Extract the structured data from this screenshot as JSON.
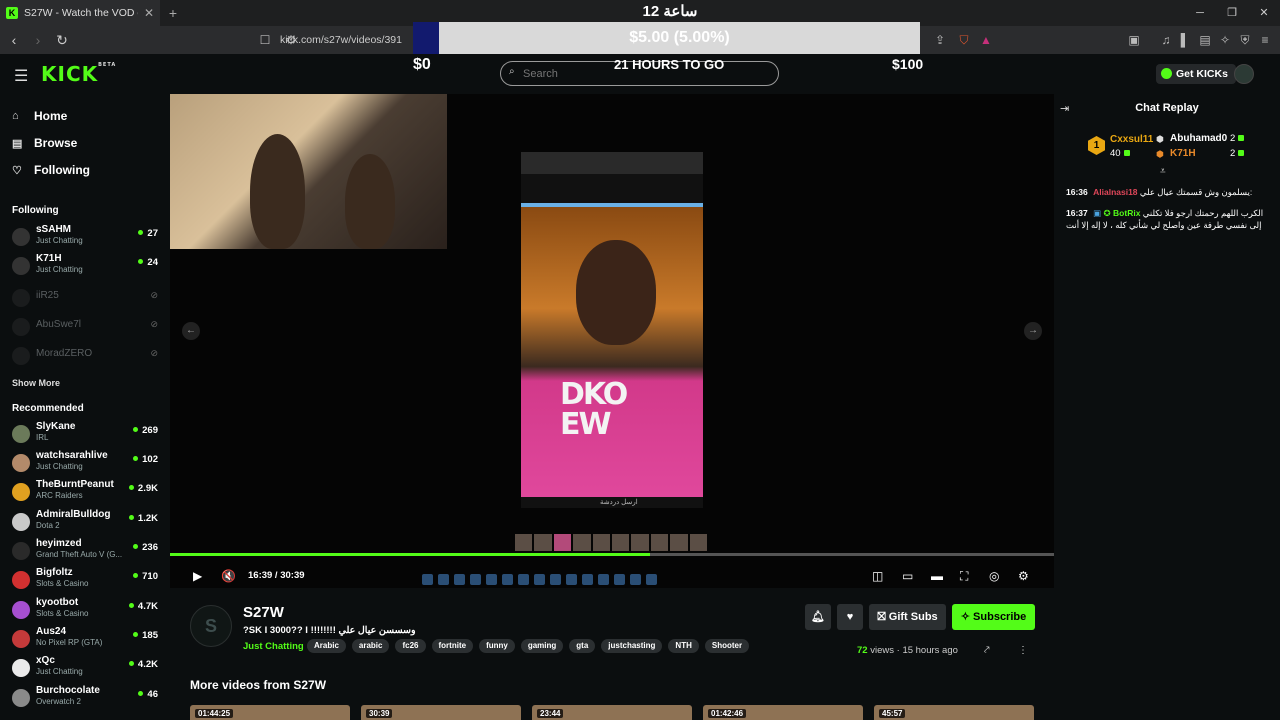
{
  "browser": {
    "tab_title": "S27W - Watch the VOD on Kick",
    "url": "kick.com/s27w/videos/391"
  },
  "overlay": {
    "arabic_time": "ساعة 12",
    "goal_progress": "$5.00 (5.00%)",
    "goal_min": "$0",
    "goal_max": "$100",
    "time_left": "21 HOURS TO GO",
    "goal_fraction": 0.05
  },
  "header": {
    "logo": "KICK",
    "logo_badge": "BETA",
    "search_placeholder": "Search",
    "get_kicks": "Get KICKs"
  },
  "sidebar": {
    "nav": [
      {
        "label": "Home",
        "icon": "home-icon"
      },
      {
        "label": "Browse",
        "icon": "browse-icon"
      },
      {
        "label": "Following",
        "icon": "heart-icon"
      }
    ],
    "following_title": "Following",
    "following": [
      {
        "name": "sSAHM",
        "category": "Just Chatting",
        "viewers": "27",
        "live": true
      },
      {
        "name": "K71H",
        "category": "Just Chatting",
        "viewers": "24",
        "live": true
      },
      {
        "name": "iiR25",
        "category": "",
        "viewers": "",
        "live": false
      },
      {
        "name": "AbuSwe7l",
        "category": "",
        "viewers": "",
        "live": false
      },
      {
        "name": "MoradZERO",
        "category": "",
        "viewers": "",
        "live": false
      }
    ],
    "show_more": "Show More",
    "recommended_title": "Recommended",
    "recommended": [
      {
        "name": "SlyKane",
        "category": "IRL",
        "viewers": "269"
      },
      {
        "name": "watchsarahlive",
        "category": "Just Chatting",
        "viewers": "102"
      },
      {
        "name": "TheBurntPeanut",
        "category": "ARC Raiders",
        "viewers": "2.9K"
      },
      {
        "name": "AdmiralBulldog",
        "category": "Dota 2",
        "viewers": "1.2K"
      },
      {
        "name": "heyimzed",
        "category": "Grand Theft Auto V (G...",
        "viewers": "236"
      },
      {
        "name": "Bigfoltz",
        "category": "Slots & Casino",
        "viewers": "710"
      },
      {
        "name": "kyootbot",
        "category": "Slots & Casino",
        "viewers": "4.7K"
      },
      {
        "name": "Aus24",
        "category": "No Pixel RP (GTA)",
        "viewers": "185"
      },
      {
        "name": "xQc",
        "category": "Just Chatting",
        "viewers": "4.2K"
      },
      {
        "name": "Burchocolate",
        "category": "Overwatch 2",
        "viewers": "46"
      }
    ]
  },
  "player": {
    "time": "16:39 / 30:39",
    "progress_fraction": 0.543,
    "shirt_text": "DKO EW",
    "phone_caption": "ارسل دردشة"
  },
  "chat": {
    "title": "Chat Replay",
    "top_gifter_rank": "1",
    "gifters": [
      {
        "name": "Cxxsul11",
        "count": "40",
        "color": "#e9a712"
      },
      {
        "name": "Abuhamad0",
        "count": "2",
        "color": "#ffffff"
      },
      {
        "name": "K71H",
        "count": "2",
        "color": "#e98a2a"
      }
    ],
    "messages": [
      {
        "time": "16:36",
        "user": "Alialnasi18",
        "user_color": "#e0475a",
        "text": "يسلمون وش قسمتك عيال علي:"
      },
      {
        "time": "16:37",
        "user": "BotRix",
        "user_color": "#53fc18",
        "text": "الكرب اللهم رحمتك ارجو فلا تكلني إلى نفسي طرفة عين واصلح لي شأني كله ، لا إله إلا أنت"
      }
    ]
  },
  "channel": {
    "initials": "S",
    "name": "S27W",
    "stream_title": "?SK I 3000?? I !!!!!!!! وسسسن عيال علي",
    "category": "Just Chatting",
    "tags": [
      "Arabic",
      "arabic",
      "fc26",
      "fortnite",
      "funny",
      "gaming",
      "gta",
      "justchasting",
      "NTH",
      "Shooter"
    ],
    "gift_subs": "Gift Subs",
    "subscribe": "Subscribe",
    "views_count": "72",
    "views_label": "views",
    "ago": "15 hours ago"
  },
  "more_videos": {
    "title": "More videos from S27W",
    "durations": [
      "01:44:25",
      "30:39",
      "23:44",
      "01:42:46",
      "45:57"
    ]
  },
  "colors": {
    "accent": "#53fc18",
    "background": "#0b0e0f"
  }
}
